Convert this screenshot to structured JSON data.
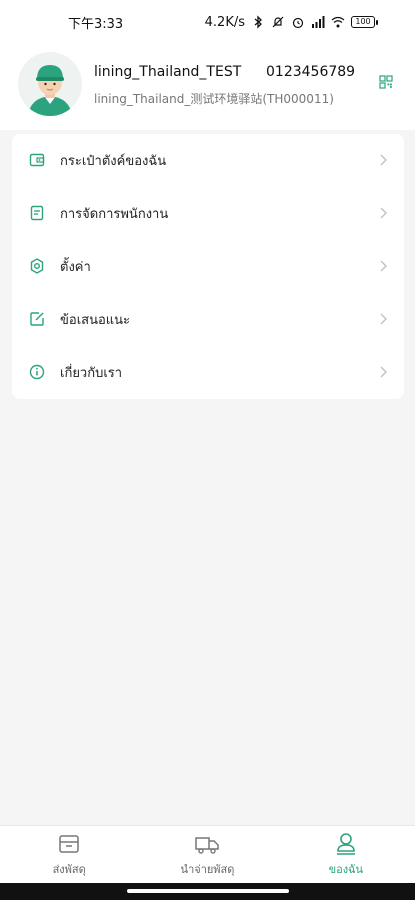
{
  "status_bar": {
    "time": "下午3:33",
    "network_speed": "4.2K/s",
    "battery": "100"
  },
  "profile": {
    "username": "lining_Thailand_TEST",
    "phone": "0123456789",
    "station": "lining_Thailand_测试环境驿站(TH000011)",
    "accent_color": "#2aa37e"
  },
  "menu": {
    "items": [
      {
        "label": "กระเป๋าตังค์ของฉัน",
        "icon": "wallet-icon"
      },
      {
        "label": "การจัดการพนักงาน",
        "icon": "staff-document-icon"
      },
      {
        "label": "ตั้งค่า",
        "icon": "settings-icon"
      },
      {
        "label": "ข้อเสนอแนะ",
        "icon": "feedback-edit-icon"
      },
      {
        "label": "เกี่ยวกับเรา",
        "icon": "info-icon"
      }
    ]
  },
  "bottom_nav": {
    "items": [
      {
        "label": "ส่งพัสดุ",
        "icon": "parcel-box-icon",
        "active": false
      },
      {
        "label": "นำจ่ายพัสดุ",
        "icon": "delivery-truck-icon",
        "active": false
      },
      {
        "label": "ของฉัน",
        "icon": "profile-person-icon",
        "active": true
      }
    ]
  }
}
